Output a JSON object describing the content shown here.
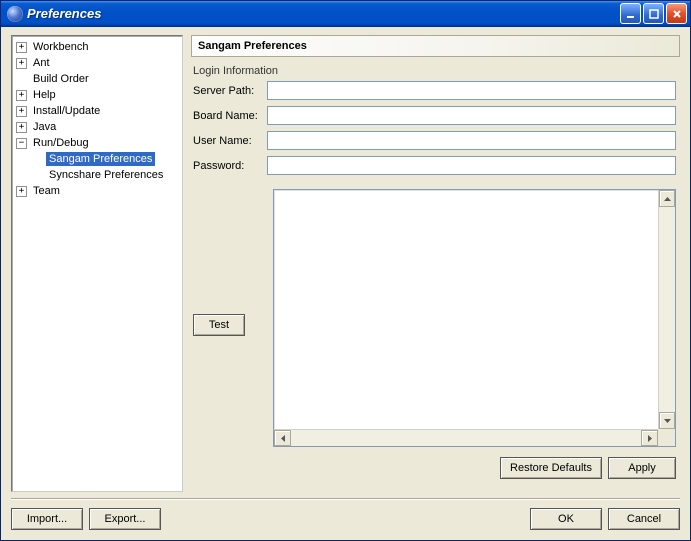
{
  "window": {
    "title": "Preferences"
  },
  "tree": {
    "items": [
      {
        "label": "Workbench",
        "expandable": true
      },
      {
        "label": "Ant",
        "expandable": true
      },
      {
        "label": "Build Order",
        "expandable": false
      },
      {
        "label": "Help",
        "expandable": true
      },
      {
        "label": "Install/Update",
        "expandable": true
      },
      {
        "label": "Java",
        "expandable": true
      },
      {
        "label": "Run/Debug",
        "expandable": true
      },
      {
        "label": "Sangam Preferences",
        "expandable": false,
        "child": true,
        "selected": true
      },
      {
        "label": "Syncshare Preferences",
        "expandable": false,
        "child": true
      },
      {
        "label": "Team",
        "expandable": true
      }
    ]
  },
  "panel": {
    "title": "Sangam Preferences",
    "group_label": "Login Information",
    "fields": {
      "server_path": {
        "label": "Server Path:",
        "value": ""
      },
      "board_name": {
        "label": "Board Name:",
        "value": ""
      },
      "user_name": {
        "label": "User Name:",
        "value": ""
      },
      "password": {
        "label": "Password:",
        "value": ""
      }
    },
    "test_label": "Test",
    "restore_defaults_label": "Restore Defaults",
    "apply_label": "Apply"
  },
  "footer": {
    "import_label": "Import...",
    "export_label": "Export...",
    "ok_label": "OK",
    "cancel_label": "Cancel"
  }
}
